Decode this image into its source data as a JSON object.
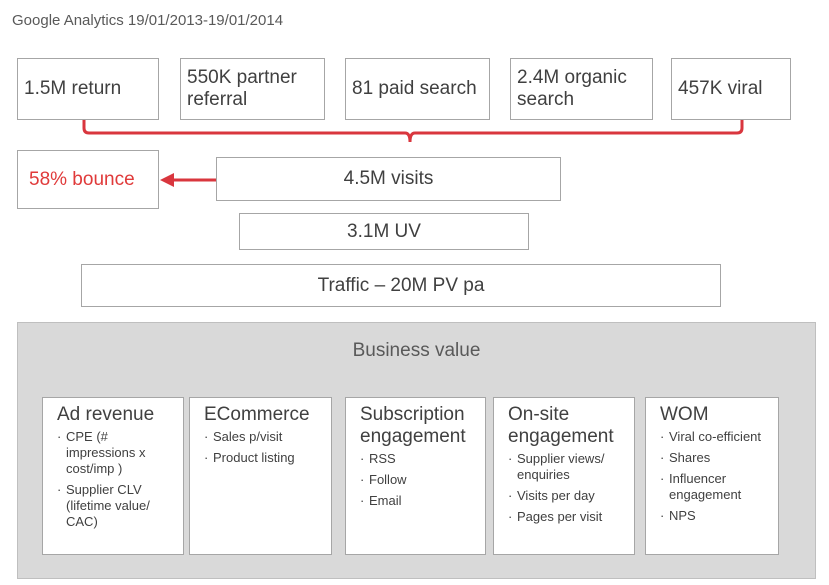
{
  "title": "Google Analytics 19/01/2013-19/01/2014",
  "sources": [
    "1.5M return",
    "550K partner referral",
    "81 paid search",
    "2.4M organic search",
    "457K viral"
  ],
  "bounce": "58% bounce",
  "visits": "4.5M visits",
  "uv": "3.1M UV",
  "traffic": "Traffic – 20M PV pa",
  "business_value": {
    "title": "Business value",
    "cards": [
      {
        "title": "Ad revenue",
        "items": [
          "CPE (# impressions x cost/imp )",
          "Supplier CLV (lifetime value/ CAC)"
        ]
      },
      {
        "title": "ECommerce",
        "items": [
          "Sales p/visit",
          "Product listing"
        ]
      },
      {
        "title": "Subscription engagement",
        "items": [
          "RSS",
          "Follow",
          "Email"
        ]
      },
      {
        "title": "On-site engagement",
        "items": [
          "Supplier views/ enquiries",
          "Visits per day",
          "Pages per visit"
        ]
      },
      {
        "title": "WOM",
        "items": [
          "Viral co-efficient",
          "Shares",
          "Influencer engagement",
          "NPS"
        ]
      }
    ]
  },
  "colors": {
    "accent": "#d9363e",
    "panel": "#d9d9d9",
    "border": "#a6a6a6"
  }
}
